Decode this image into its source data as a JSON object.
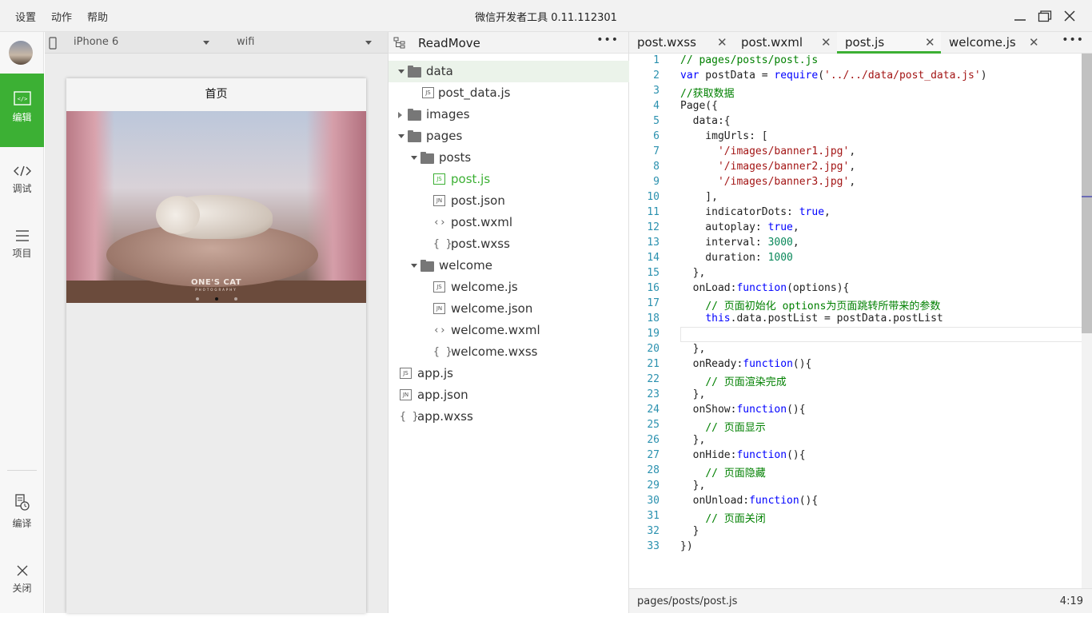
{
  "titlebar": {
    "menus": [
      "设置",
      "动作",
      "帮助"
    ],
    "title": "微信开发者工具 0.11.112301"
  },
  "leftnav": {
    "items": [
      {
        "label": "编辑",
        "icon": "code-editor-icon",
        "active": true
      },
      {
        "label": "调试",
        "icon": "debug-icon"
      },
      {
        "label": "项目",
        "icon": "menu-icon"
      },
      {
        "label": "编译",
        "icon": "compile-icon"
      },
      {
        "label": "关闭",
        "icon": "close-icon"
      }
    ]
  },
  "simulator": {
    "device": "iPhone 6",
    "network": "wifi",
    "page_title": "首页",
    "banner_brand": "ONE'S CAT",
    "banner_sub": "PHOTOGRAPHY"
  },
  "explorer": {
    "project": "ReadMove",
    "tree": [
      {
        "label": "data",
        "type": "folder",
        "level": 0,
        "expanded": true,
        "selected": true
      },
      {
        "label": "post_data.js",
        "type": "js",
        "level": 1
      },
      {
        "label": "images",
        "type": "folder",
        "level": 0,
        "expanded": false
      },
      {
        "label": "pages",
        "type": "folder",
        "level": 0,
        "expanded": true
      },
      {
        "label": "posts",
        "type": "folder",
        "level": 1,
        "expanded": true
      },
      {
        "label": "post.js",
        "type": "js",
        "level": 2,
        "active": true
      },
      {
        "label": "post.json",
        "type": "json",
        "level": 2
      },
      {
        "label": "post.wxml",
        "type": "wxml",
        "level": 2
      },
      {
        "label": "post.wxss",
        "type": "wxss",
        "level": 2
      },
      {
        "label": "welcome",
        "type": "folder",
        "level": 1,
        "expanded": true
      },
      {
        "label": "welcome.js",
        "type": "js",
        "level": 2
      },
      {
        "label": "welcome.json",
        "type": "json",
        "level": 2
      },
      {
        "label": "welcome.wxml",
        "type": "wxml",
        "level": 2
      },
      {
        "label": "welcome.wxss",
        "type": "wxss",
        "level": 2
      },
      {
        "label": "app.js",
        "type": "js",
        "level": 0
      },
      {
        "label": "app.json",
        "type": "json",
        "level": 0
      },
      {
        "label": "app.wxss",
        "type": "wxss",
        "level": 0
      }
    ]
  },
  "editor": {
    "tabs": [
      {
        "label": "post.wxss"
      },
      {
        "label": "post.wxml"
      },
      {
        "label": "post.js",
        "active": true
      },
      {
        "label": "welcome.js"
      }
    ],
    "lines": [
      "// pages/posts/post.js",
      "var postData = require('../../data/post_data.js')",
      "//获取数据",
      "Page({",
      "  data:{",
      "    imgUrls: [",
      "      '/images/banner1.jpg',",
      "      '/images/banner2.jpg',",
      "      '/images/banner3.jpg',",
      "    ],",
      "    indicatorDots: true,",
      "    autoplay: true,",
      "    interval: 3000,",
      "    duration: 1000",
      "  },",
      "  onLoad:function(options){",
      "    // 页面初始化 options为页面跳转所带来的参数",
      "    this.data.postList = postData.postList",
      "",
      "  },",
      "  onReady:function(){",
      "    // 页面渲染完成",
      "  },",
      "  onShow:function(){",
      "    // 页面显示",
      "  },",
      "  onHide:function(){",
      "    // 页面隐藏",
      "  },",
      "  onUnload:function(){",
      "    // 页面关闭",
      "  }",
      "})"
    ],
    "current_line": 19,
    "status_path": "pages/posts/post.js",
    "status_pos": "4:19"
  },
  "colors": {
    "accent": "#3cb034",
    "comment": "#008000",
    "keyword": "#0000ff",
    "string": "#a31515",
    "number": "#09885a",
    "line_number": "#2b91af"
  }
}
